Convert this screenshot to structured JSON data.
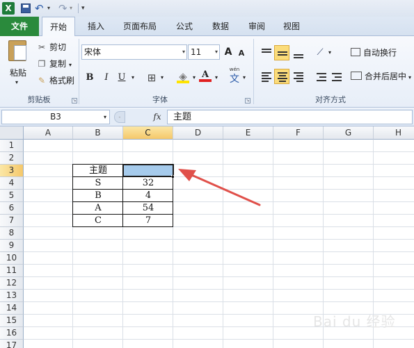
{
  "qat": {
    "app_icon": "X",
    "icons": [
      "excel-logo-icon",
      "save-icon",
      "undo-icon",
      "redo-icon",
      "customize-icon"
    ]
  },
  "tabs": {
    "file": "文件",
    "home": "开始",
    "insert": "插入",
    "page_layout": "页面布局",
    "formulas": "公式",
    "data": "数据",
    "review": "审阅",
    "view": "视图"
  },
  "clipboard": {
    "paste": "粘贴",
    "cut": "剪切",
    "copy": "复制",
    "format_painter": "格式刷",
    "group_label": "剪贴板"
  },
  "font": {
    "name": "宋体",
    "size": "11",
    "grow": "A",
    "shrink": "A",
    "bold": "B",
    "italic": "I",
    "underline": "U",
    "font_color": "A",
    "phonetic": "wén",
    "phonetic_char": "文",
    "group_label": "字体"
  },
  "alignment": {
    "wrap_text": "自动换行",
    "merge_center": "合并后居中",
    "group_label": "对齐方式"
  },
  "formula_bar": {
    "name_box": "B3",
    "fx": "fx",
    "content": "主题"
  },
  "grid": {
    "columns": [
      "A",
      "B",
      "C",
      "D",
      "E",
      "F",
      "G",
      "H"
    ],
    "rows": [
      "1",
      "2",
      "3",
      "4",
      "5",
      "6",
      "7",
      "8",
      "9",
      "10",
      "11",
      "12",
      "13",
      "14",
      "15",
      "16",
      "17"
    ],
    "active_column": "C",
    "active_row": "3",
    "table": [
      [
        "主题",
        ""
      ],
      [
        "S",
        "32"
      ],
      [
        "B",
        "4"
      ],
      [
        "A",
        "54"
      ],
      [
        "C",
        "7"
      ]
    ]
  },
  "colors": {
    "file_tab": "#2a8a3c",
    "selection": "#a6cbec",
    "arrow": "#e0504a",
    "highlight_header": "#f5c86a"
  },
  "watermark": "Bai du 经验"
}
